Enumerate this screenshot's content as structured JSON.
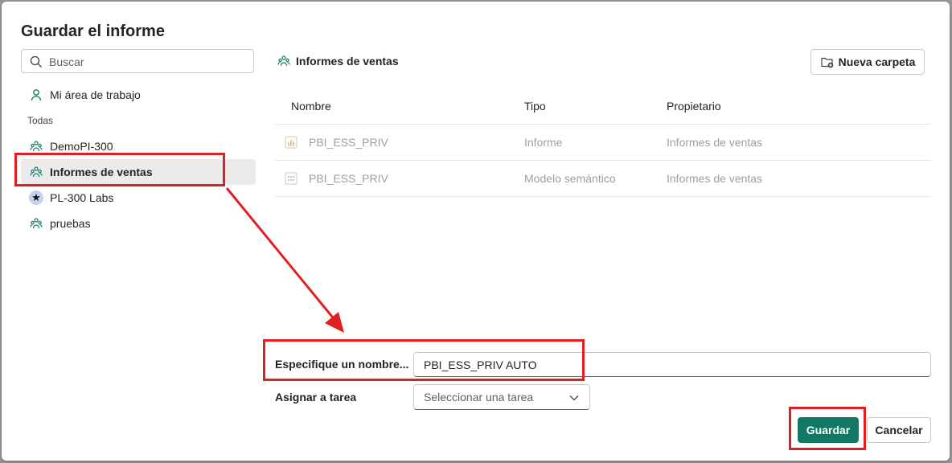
{
  "dialog": {
    "title": "Guardar el informe"
  },
  "sidebar": {
    "search_placeholder": "Buscar",
    "my_workspace": "Mi área de trabajo",
    "section_label": "Todas",
    "items": [
      {
        "label": "DemoPI-300",
        "icon": "workspace-icon"
      },
      {
        "label": "Informes de ventas",
        "icon": "workspace-icon",
        "selected": true
      },
      {
        "label": "PL-300 Labs",
        "icon": "star-icon"
      },
      {
        "label": "pruebas",
        "icon": "workspace-icon"
      }
    ]
  },
  "main": {
    "workspace_title": "Informes de ventas",
    "new_folder_label": "Nueva carpeta",
    "columns": [
      "Nombre",
      "Tipo",
      "Propietario"
    ],
    "rows": [
      {
        "name": "PBI_ESS_PRIV",
        "type": "Informe",
        "owner": "Informes de ventas",
        "icon": "report-icon"
      },
      {
        "name": "PBI_ESS_PRIV",
        "type": "Modelo semántico",
        "owner": "Informes de ventas",
        "icon": "semantic-model-icon"
      }
    ]
  },
  "form": {
    "name_label": "Especifique un nombre...",
    "name_value": "PBI_ESS_PRIV AUTO",
    "task_label": "Asignar a tarea",
    "task_placeholder": "Seleccionar una tarea"
  },
  "buttons": {
    "save": "Guardar",
    "cancel": "Cancelar"
  },
  "colors": {
    "primary": "#117865",
    "annotation": "#e02020",
    "workspace_icon": "#117865"
  }
}
